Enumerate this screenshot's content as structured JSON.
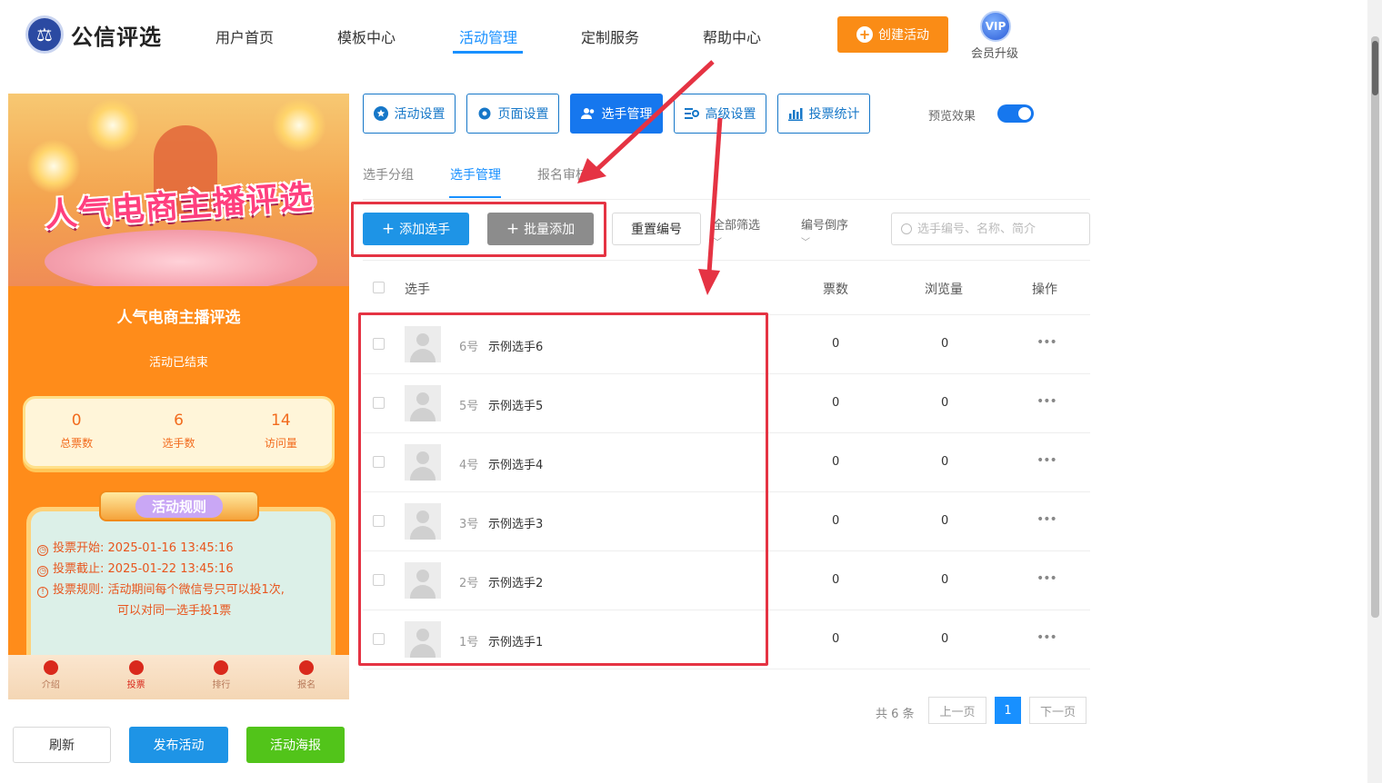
{
  "header": {
    "brand": "公信评选",
    "nav": [
      "用户首页",
      "模板中心",
      "活动管理",
      "定制服务",
      "帮助中心"
    ],
    "create_button": "创建活动",
    "vip_badge": "VIP",
    "vip_label": "会员升级"
  },
  "preview": {
    "banner_title": "人气电商主播评选",
    "title": "人气电商主播评选",
    "status": "活动已结束",
    "stats": [
      {
        "value": "0",
        "label": "总票数"
      },
      {
        "value": "6",
        "label": "选手数"
      },
      {
        "value": "14",
        "label": "访问量"
      }
    ],
    "rules_title": "活动规则",
    "rules": [
      {
        "label": "投票开始:",
        "value": "2025-01-16 13:45:16"
      },
      {
        "label": "投票截止:",
        "value": "2025-01-22 13:45:16"
      },
      {
        "label": "投票规则:",
        "value": "活动期间每个微信号只可以投1次,",
        "value2": "可以对同一选手投1票"
      }
    ],
    "tabs": [
      "介绍",
      "投票",
      "排行",
      "报名"
    ]
  },
  "bottom_buttons": {
    "refresh": "刷新",
    "publish": "发布活动",
    "poster": "活动海报"
  },
  "toolbar": {
    "buttons": [
      "活动设置",
      "页面设置",
      "选手管理",
      "高级设置",
      "投票统计"
    ],
    "preview_label": "预览效果",
    "preview_on": true
  },
  "subtabs": [
    "选手分组",
    "选手管理",
    "报名审核"
  ],
  "actions": {
    "add": "添加选手",
    "batch": "批量添加",
    "reset": "重置编号",
    "filter_all": "全部筛选",
    "filter_order": "编号倒序",
    "search_placeholder": "选手编号、名称、简介"
  },
  "table": {
    "headers": {
      "player": "选手",
      "votes": "票数",
      "views": "浏览量",
      "ops": "操作"
    },
    "rows": [
      {
        "no": "6号",
        "name": "示例选手6",
        "votes": "0",
        "views": "0"
      },
      {
        "no": "5号",
        "name": "示例选手5",
        "votes": "0",
        "views": "0"
      },
      {
        "no": "4号",
        "name": "示例选手4",
        "votes": "0",
        "views": "0"
      },
      {
        "no": "3号",
        "name": "示例选手3",
        "votes": "0",
        "views": "0"
      },
      {
        "no": "2号",
        "name": "示例选手2",
        "votes": "0",
        "views": "0"
      },
      {
        "no": "1号",
        "name": "示例选手1",
        "votes": "0",
        "views": "0"
      }
    ]
  },
  "pagination": {
    "total": "共 6 条",
    "prev": "上一页",
    "current": "1",
    "next": "下一页"
  },
  "colors": {
    "primary": "#1890ff",
    "orange": "#fa8c16",
    "green": "#52c41a",
    "annotation": "#e53343"
  }
}
